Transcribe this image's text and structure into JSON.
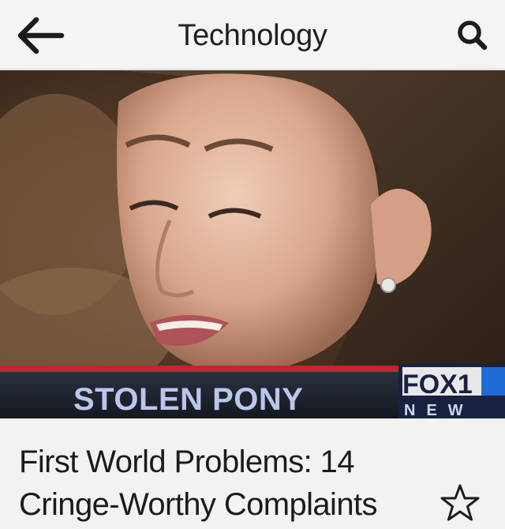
{
  "header": {
    "title": "Technology",
    "back_icon": "back-arrow-icon",
    "search_icon": "search-icon"
  },
  "hero": {
    "caption": "STOLEN PONY",
    "network_logo": "FOX1",
    "network_sub": "NEW"
  },
  "article": {
    "headline": "First World Problems: 14 Cringe-Worthy Complaints",
    "bookmark_icon": "star-outline-icon"
  }
}
